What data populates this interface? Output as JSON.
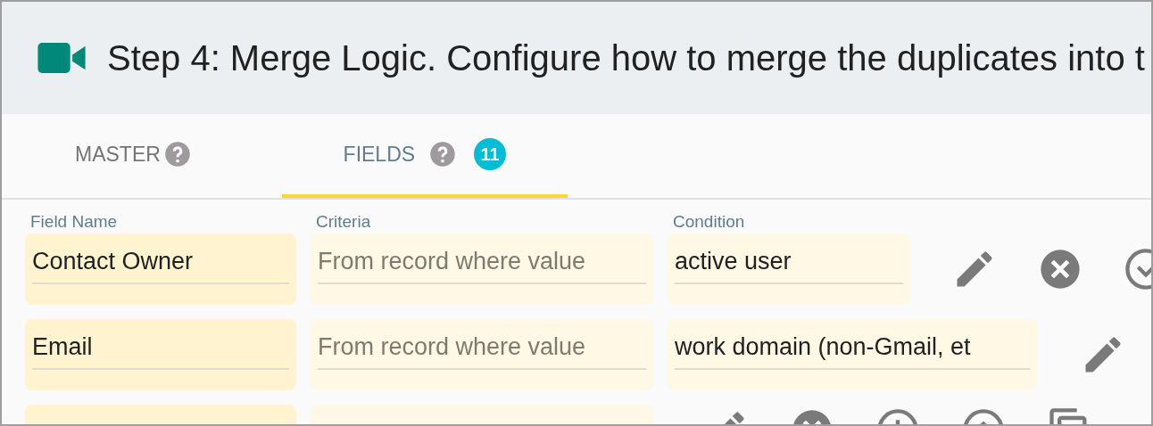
{
  "header": {
    "title": "Step 4: Merge Logic. Configure how to merge the duplicates into t"
  },
  "tabs": [
    {
      "label": "MASTER",
      "selected": false,
      "help": true
    },
    {
      "label": "FIELDS",
      "selected": true,
      "help": true,
      "count": "11"
    }
  ],
  "columns": [
    "Field Name",
    "Criteria",
    "Condition"
  ],
  "rows": [
    {
      "field_name": "Contact Owner",
      "criteria": {
        "placeholder": "From record where value"
      },
      "condition": "active user",
      "actions": [
        {
          "kind": "edit"
        },
        {
          "kind": "remove"
        },
        {
          "kind": "move-down"
        }
      ]
    },
    {
      "field_name": "Email",
      "criteria": {
        "placeholder": "From record where value"
      },
      "condition": "work domain (non-Gmail, et",
      "actions": [
        {
          "kind": "edit"
        }
      ]
    },
    {
      "actions": [
        {
          "kind": "edit"
        },
        {
          "kind": "remove"
        },
        {
          "kind": "add"
        },
        {
          "kind": "move-up"
        },
        {
          "kind": "copy"
        }
      ]
    }
  ]
}
